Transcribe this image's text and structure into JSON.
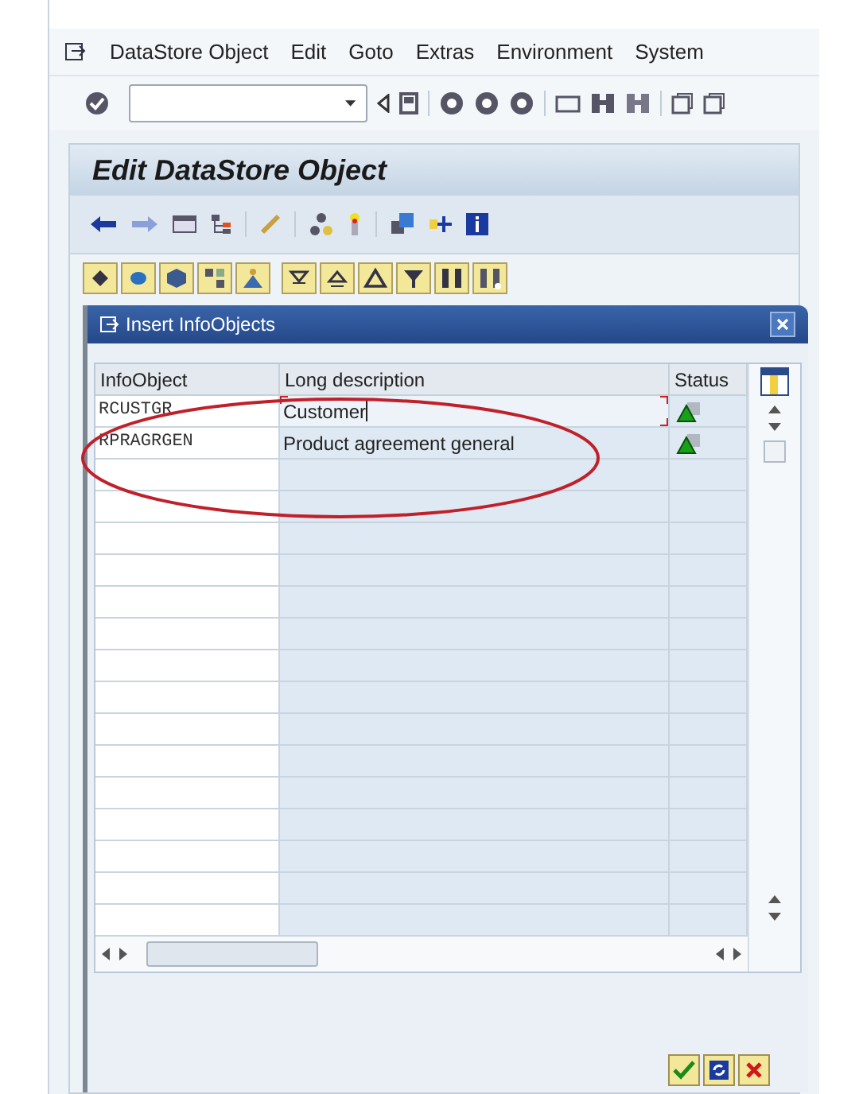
{
  "menu_bar": {
    "items": [
      "DataStore Object",
      "Edit",
      "Goto",
      "Extras",
      "Environment",
      "System"
    ]
  },
  "screen_title": "Edit DataStore Object",
  "dialog": {
    "title": "Insert InfoObjects",
    "table": {
      "columns": [
        "InfoObject",
        "Long description",
        "Status"
      ],
      "rows": [
        {
          "infoobject": "RCUSTGR",
          "long_description": "Customer",
          "focused": true
        },
        {
          "infoobject": "RPRAGRGEN",
          "long_description": "Product agreement general",
          "focused": false
        }
      ]
    }
  }
}
